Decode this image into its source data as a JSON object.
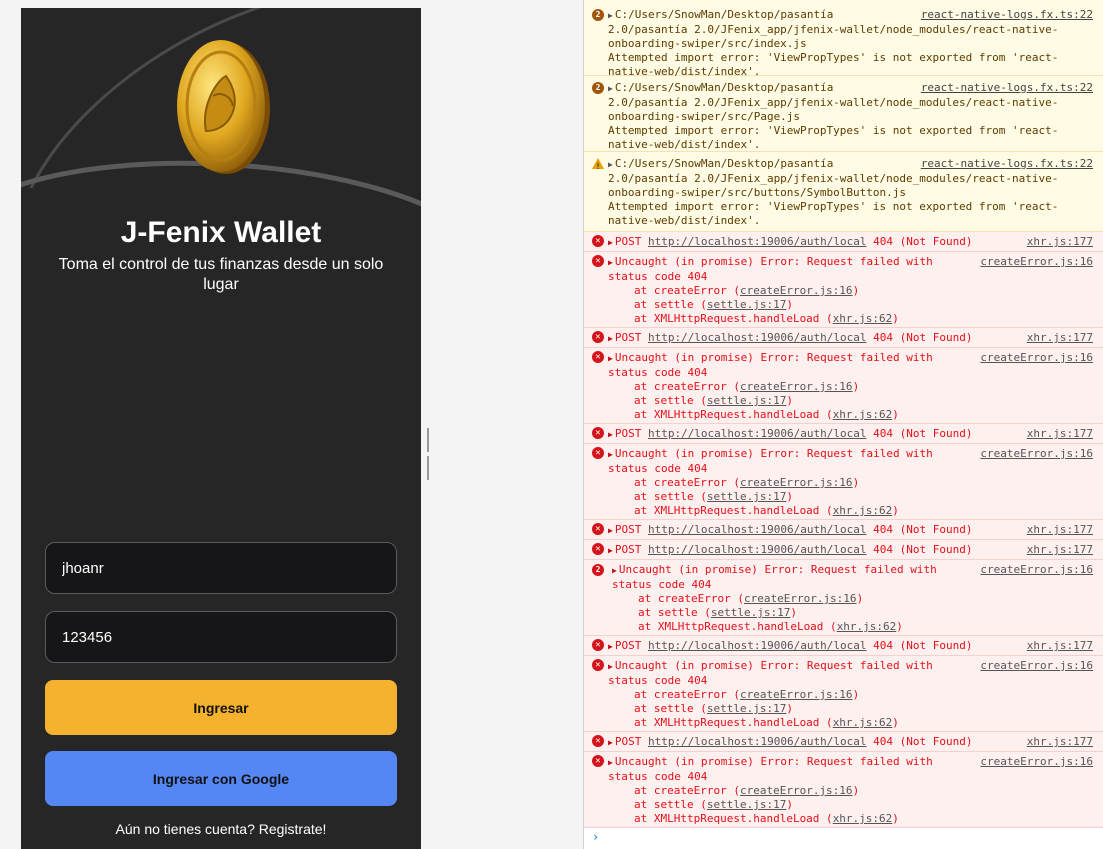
{
  "app": {
    "title": "J-Fenix Wallet",
    "subtitle": "Toma el control de tus finanzas desde un solo lugar",
    "username_value": "jhoanr",
    "password_value": "123456",
    "login_label": "Ingresar",
    "google_label": "Ingresar con Google",
    "register_text": "Aún no tienes cuenta? Registrate!",
    "colors": {
      "background": "#262627",
      "login_button": "#f4b22f",
      "google_button": "#5486f4",
      "field_bg": "#161618"
    }
  },
  "console": {
    "warnings": [
      {
        "count": "2",
        "path": "C:/Users/SnowMan/Desktop/pasantía 2.0/pasantía 2.0/JFenix_app/jfenix-wallet/node_modules/react-native-onboarding-swiper/src/index.js",
        "message": "Attempted import error: 'ViewPropTypes' is not exported from 'react-native-web/dist/index'.",
        "source": "react-native-logs.fx.ts:22"
      },
      {
        "count": "2",
        "path": "C:/Users/SnowMan/Desktop/pasantía 2.0/pasantía 2.0/JFenix_app/jfenix-wallet/node_modules/react-native-onboarding-swiper/src/Page.js",
        "message": "Attempted import error: 'ViewPropTypes' is not exported from 'react-native-web/dist/index'.",
        "source": "react-native-logs.fx.ts:22"
      },
      {
        "count": "",
        "path": "C:/Users/SnowMan/Desktop/pasantía 2.0/pasantía 2.0/JFenix_app/jfenix-wallet/node_modules/react-native-onboarding-swiper/src/buttons/SymbolButton.js",
        "message": "Attempted import error: 'ViewPropTypes' is not exported from 'react-native-web/dist/index'.",
        "source": "react-native-logs.fx.ts:22"
      }
    ],
    "post": {
      "method": "POST",
      "url": "http://localhost:19006/auth/local",
      "status": "404 (Not Found)",
      "source": "xhr.js:177"
    },
    "uncaught": {
      "message": "Uncaught (in promise) Error: Request failed with status code 404",
      "source": "createError.js:16",
      "stack": [
        {
          "fn": "at createError (",
          "file": "createError.js:16",
          "end": ")"
        },
        {
          "fn": "at settle (",
          "file": "settle.js:17",
          "end": ")"
        },
        {
          "fn": "at XMLHttpRequest.handleLoad (",
          "file": "xhr.js:62",
          "end": ")"
        }
      ]
    },
    "grouped_count": "2",
    "prompt": "›"
  }
}
